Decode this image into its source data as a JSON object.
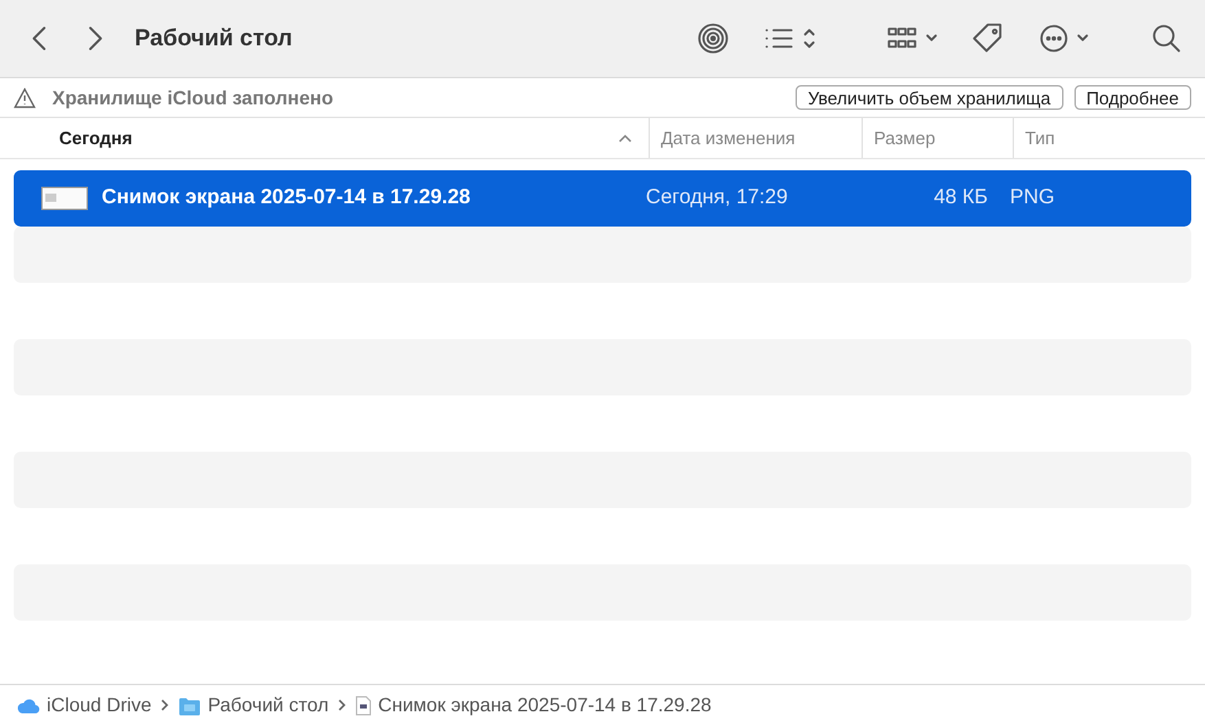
{
  "toolbar": {
    "title": "Рабочий стол"
  },
  "banner": {
    "message": "Хранилище iCloud заполнено",
    "buttons": [
      "Увеличить объем хранилища",
      "Подробнее"
    ]
  },
  "table": {
    "columns": [
      {
        "label": "Сегодня",
        "sorted": true
      },
      {
        "label": "Дата изменения",
        "sorted": false
      },
      {
        "label": "Размер",
        "sorted": false
      },
      {
        "label": "Тип",
        "sorted": false
      }
    ],
    "rows": [
      {
        "name": "Снимок экрана 2025-07-14 в 17.29.28",
        "date": "Сегодня, 17:29",
        "size": "48 КБ",
        "type": "PNG",
        "selected": true
      }
    ]
  },
  "path_bar": [
    {
      "kind": "cloud",
      "label": "iCloud Drive"
    },
    {
      "kind": "folder",
      "label": "Рабочий стол"
    },
    {
      "kind": "file",
      "label": "Снимок экрана 2025-07-14 в 17.29.28"
    }
  ]
}
